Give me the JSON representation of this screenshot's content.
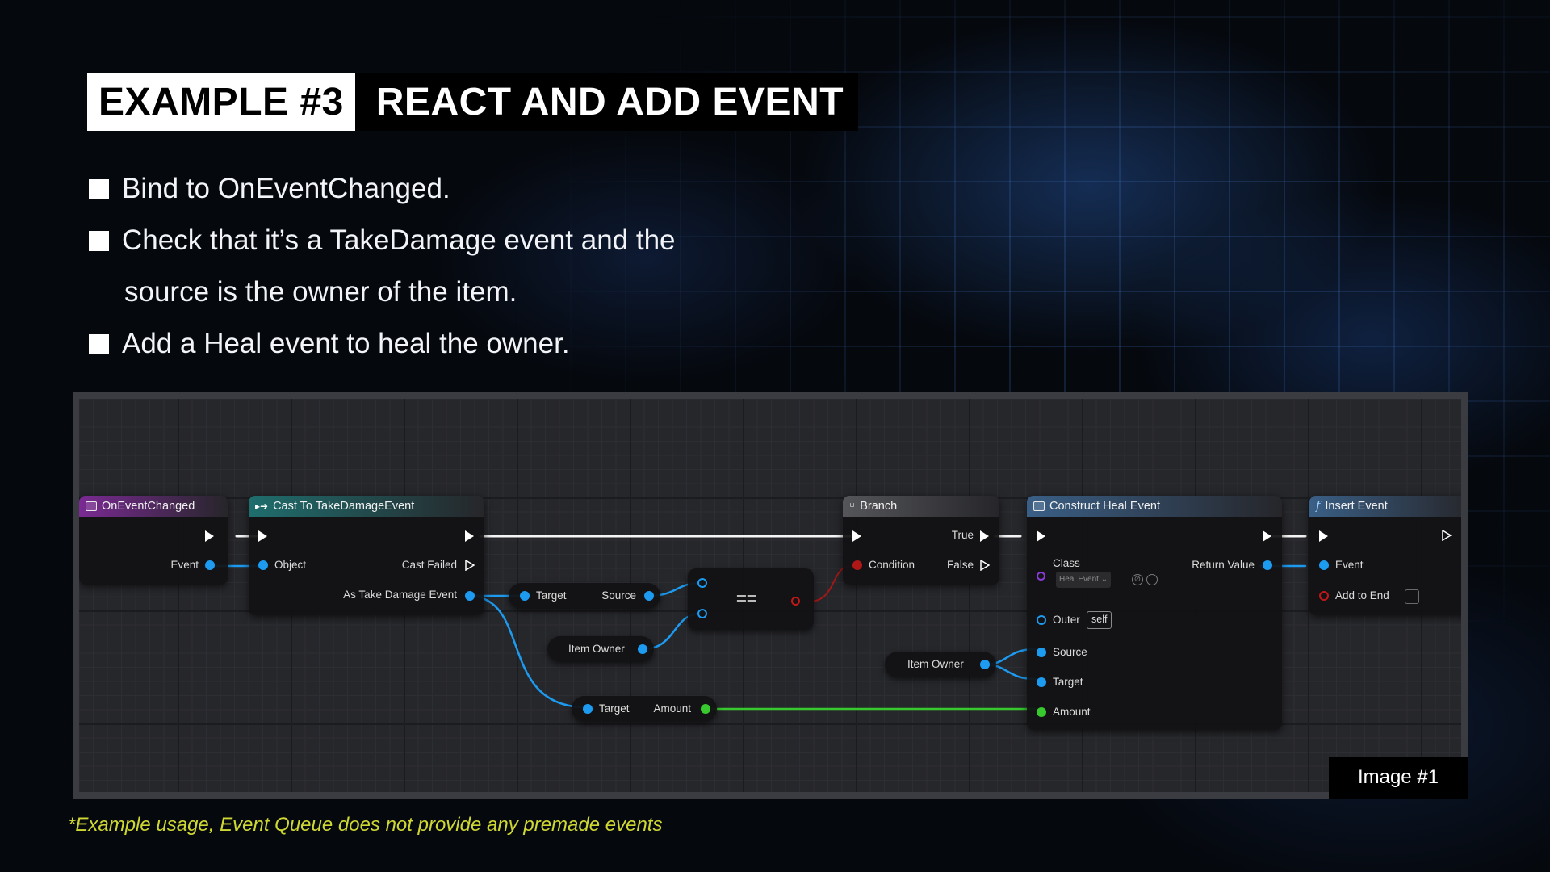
{
  "title": {
    "tag": "EXAMPLE #3",
    "text": "REACT AND ADD EVENT"
  },
  "bullets": [
    {
      "text": "Bind to OnEventChanged."
    },
    {
      "text": "Check that it’s a TakeDamage event and the",
      "continuation": "source is the owner of the item."
    },
    {
      "text": "Add a Heal event to heal the owner."
    }
  ],
  "graph": {
    "nodes": {
      "on_event_changed": {
        "title": "OnEventChanged",
        "header_color": "#7a2a93",
        "pins": {
          "event": "Event"
        }
      },
      "cast": {
        "title": "Cast To TakeDamageEvent",
        "header_color": "#1f6e6e",
        "pins": {
          "object": "Object",
          "cast_failed": "Cast Failed",
          "as_event": "As Take Damage Event"
        }
      },
      "get_source": {
        "pins": {
          "target": "Target",
          "source": "Source"
        }
      },
      "item_owner_1": {
        "label": "Item Owner"
      },
      "equal": {
        "label": "=="
      },
      "get_amount": {
        "pins": {
          "target": "Target",
          "amount": "Amount"
        }
      },
      "branch": {
        "title": "Branch",
        "header_color": "#55565a",
        "pins": {
          "true": "True",
          "condition": "Condition",
          "false": "False"
        }
      },
      "item_owner_2": {
        "label": "Item Owner"
      },
      "construct": {
        "title": "Construct Heal Event",
        "header_color": "#3a5f86",
        "pins": {
          "class": "Class",
          "class_value": "Heal Event",
          "return_value": "Return Value",
          "outer": "Outer",
          "outer_value": "self",
          "source": "Source",
          "target": "Target",
          "amount": "Amount"
        }
      },
      "insert": {
        "title": "Insert Event",
        "header_color": "#3a5f86",
        "pins": {
          "event": "Event",
          "add_to_end": "Add to End"
        }
      }
    },
    "wire_colors": {
      "exec": "#f5f5f5",
      "object": "#1d9bf0",
      "float": "#37c92e",
      "bool": "#a01818"
    }
  },
  "image_label": "Image #1",
  "footnote": "*Example usage, Event Queue does not provide any premade events"
}
